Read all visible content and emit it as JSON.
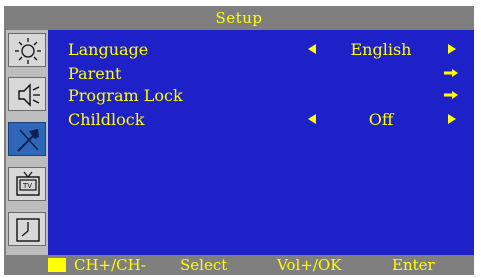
{
  "title": "Setup",
  "menu": [
    {
      "label": "Language",
      "value": "English",
      "control": "select"
    },
    {
      "label": "Parent",
      "value": "",
      "control": "enter"
    },
    {
      "label": "Program Lock",
      "value": "",
      "control": "enter"
    },
    {
      "label": "Childlock",
      "value": "Off",
      "control": "select"
    }
  ],
  "sidebar": [
    {
      "name": "brightness-icon",
      "active": false
    },
    {
      "name": "speaker-icon",
      "active": false
    },
    {
      "name": "tools-icon",
      "active": true
    },
    {
      "name": "tv-icon",
      "active": false
    },
    {
      "name": "clock-icon",
      "active": false
    }
  ],
  "footer": {
    "ch": "CH+/CH-",
    "select": "Select",
    "vol_ok": "Vol+/OK",
    "enter": "Enter"
  },
  "colors": {
    "frame": "#7f7f7f",
    "panel": "#1f21c8",
    "text": "#ffff00",
    "active_icon_bg": "#2e67b8"
  }
}
